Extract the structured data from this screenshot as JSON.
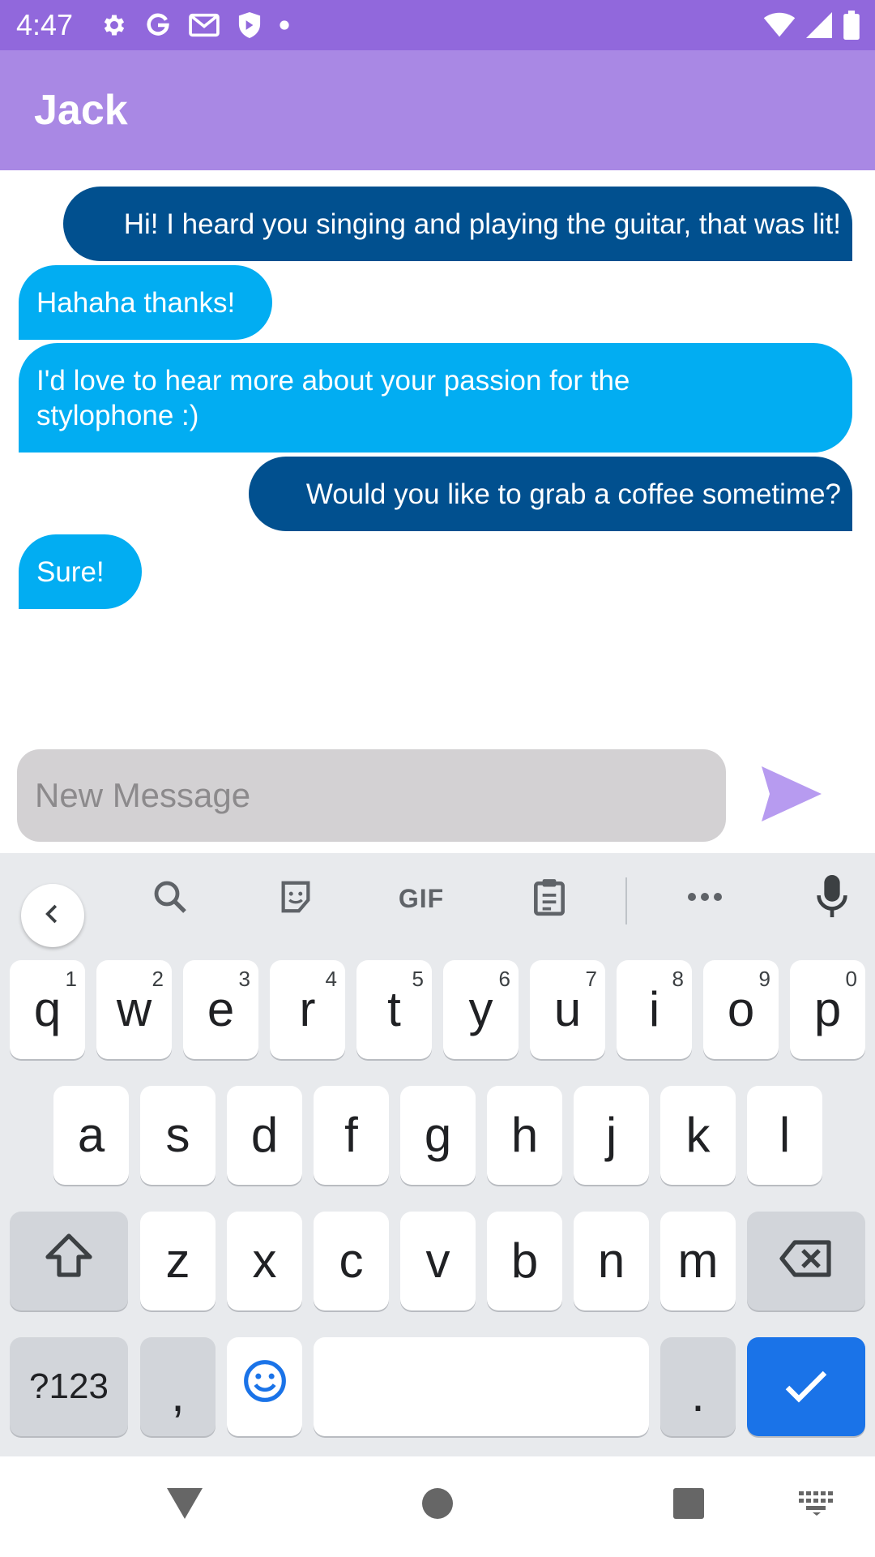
{
  "status_bar": {
    "time": "4:47",
    "left_icons": [
      "gear-icon",
      "google-g-icon",
      "gmail-icon",
      "shield-icon",
      "dot-icon"
    ],
    "right_icons": [
      "wifi-icon",
      "signal-icon",
      "battery-icon"
    ]
  },
  "app_bar": {
    "title": "Jack",
    "color": "#a988e4"
  },
  "messages": [
    {
      "direction": "sent",
      "text": "Hi! I heard you singing and playing the guitar, that was lit!"
    },
    {
      "direction": "received",
      "text": "Hahaha thanks!"
    },
    {
      "direction": "received",
      "text": "I'd love to hear more about your passion for the stylophone :)"
    },
    {
      "direction": "sent",
      "text": "Would you like to grab a coffee sometime?"
    },
    {
      "direction": "received",
      "text": "Sure!"
    }
  ],
  "compose": {
    "placeholder": "New Message",
    "value": "",
    "send_icon": "send-icon"
  },
  "keyboard": {
    "toolbar": [
      "chevron-left-icon",
      "search-icon",
      "sticker-icon",
      "gif-icon",
      "clipboard-icon",
      "more-icon",
      "microphone-icon"
    ],
    "gif_label": "GIF",
    "row1": [
      {
        "key": "q",
        "hint": "1"
      },
      {
        "key": "w",
        "hint": "2"
      },
      {
        "key": "e",
        "hint": "3"
      },
      {
        "key": "r",
        "hint": "4"
      },
      {
        "key": "t",
        "hint": "5"
      },
      {
        "key": "y",
        "hint": "6"
      },
      {
        "key": "u",
        "hint": "7"
      },
      {
        "key": "i",
        "hint": "8"
      },
      {
        "key": "o",
        "hint": "9"
      },
      {
        "key": "p",
        "hint": "0"
      }
    ],
    "row2": [
      "a",
      "s",
      "d",
      "f",
      "g",
      "h",
      "j",
      "k",
      "l"
    ],
    "row3": [
      "z",
      "x",
      "c",
      "v",
      "b",
      "n",
      "m"
    ],
    "symbols_label": "?123",
    "comma_label": ",",
    "period_label": ".",
    "accent_color": "#1a73e8"
  },
  "nav_bar": {
    "icons": [
      "back-triangle-icon",
      "home-circle-icon",
      "recents-square-icon",
      "keyboard-switch-icon"
    ]
  },
  "colors": {
    "status_bar": "#9168dc",
    "sent_bubble": "#01508f",
    "received_bubble": "#02adf2",
    "send_icon": "#b79bf0"
  }
}
